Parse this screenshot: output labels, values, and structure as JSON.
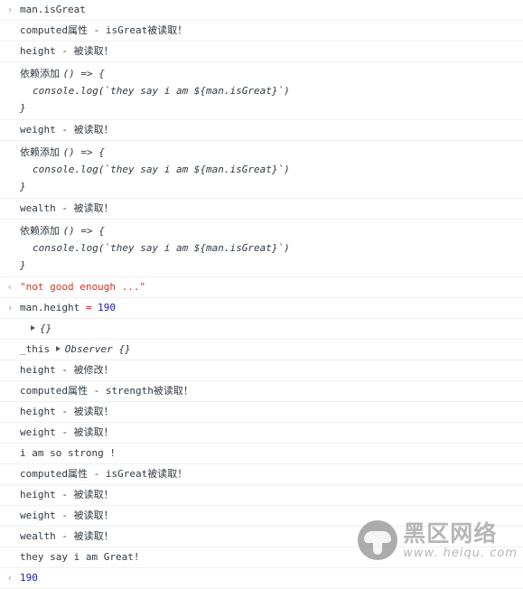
{
  "console": {
    "markers": {
      "input": "›",
      "output": "‹",
      "expand": "▸"
    },
    "rows": [
      {
        "kind": "input",
        "marker": "›",
        "text": "man.isGreat"
      },
      {
        "kind": "log",
        "marker": "",
        "text": "computed属性 - isGreat被读取！"
      },
      {
        "kind": "log",
        "marker": "",
        "text": "height - 被读取！"
      },
      {
        "kind": "code",
        "marker": "",
        "label": "依赖添加 ",
        "line1": "() => {",
        "line2": "console.log(`they say i am ${man.isGreat}`)",
        "line3": "}"
      },
      {
        "kind": "log",
        "marker": "",
        "text": "weight - 被读取！"
      },
      {
        "kind": "code",
        "marker": "",
        "label": "依赖添加 ",
        "line1": "() => {",
        "line2": "console.log(`they say i am ${man.isGreat}`)",
        "line3": "}"
      },
      {
        "kind": "log",
        "marker": "",
        "text": "wealth - 被读取！"
      },
      {
        "kind": "code",
        "marker": "",
        "label": "依赖添加 ",
        "line1": "() => {",
        "line2": "console.log(`they say i am ${man.isGreat}`)",
        "line3": "}"
      },
      {
        "kind": "result-string",
        "marker": "‹",
        "text": "\"not good enough ...\""
      },
      {
        "kind": "assignment",
        "marker": "›",
        "target": "man.height ",
        "operator": "=",
        "value": " 190"
      },
      {
        "kind": "object",
        "marker": "",
        "disclosure": "▸",
        "text": "{}"
      },
      {
        "kind": "observer",
        "marker": "",
        "name": "_this ",
        "disclosure": "▸",
        "text": "Observer {}"
      },
      {
        "kind": "log",
        "marker": "",
        "text": "height - 被修改！"
      },
      {
        "kind": "log",
        "marker": "",
        "text": "computed属性 - strength被读取！"
      },
      {
        "kind": "log",
        "marker": "",
        "text": "height - 被读取！"
      },
      {
        "kind": "log",
        "marker": "",
        "text": "weight - 被读取！"
      },
      {
        "kind": "log",
        "marker": "",
        "text": "i am so strong !"
      },
      {
        "kind": "log",
        "marker": "",
        "text": "computed属性 - isGreat被读取！"
      },
      {
        "kind": "log",
        "marker": "",
        "text": "height - 被读取！"
      },
      {
        "kind": "log",
        "marker": "",
        "text": "weight - 被读取！"
      },
      {
        "kind": "log",
        "marker": "",
        "text": "wealth - 被读取！"
      },
      {
        "kind": "log",
        "marker": "",
        "text": "they say i am Great!"
      },
      {
        "kind": "result-number",
        "marker": "‹",
        "text": "190"
      }
    ]
  },
  "watermark": {
    "cn": "黑区网络",
    "url": "www. heiqu. com",
    "logo": "mushroom-logo"
  },
  "colors": {
    "text": "#303942",
    "string": "#d93025",
    "number": "#1a1aa6",
    "operator": "#c5221f",
    "gutter": "#a0a0a0",
    "divider": "#f0f0f0",
    "background": "#ffffff",
    "watermark": "#9a9a9a"
  }
}
